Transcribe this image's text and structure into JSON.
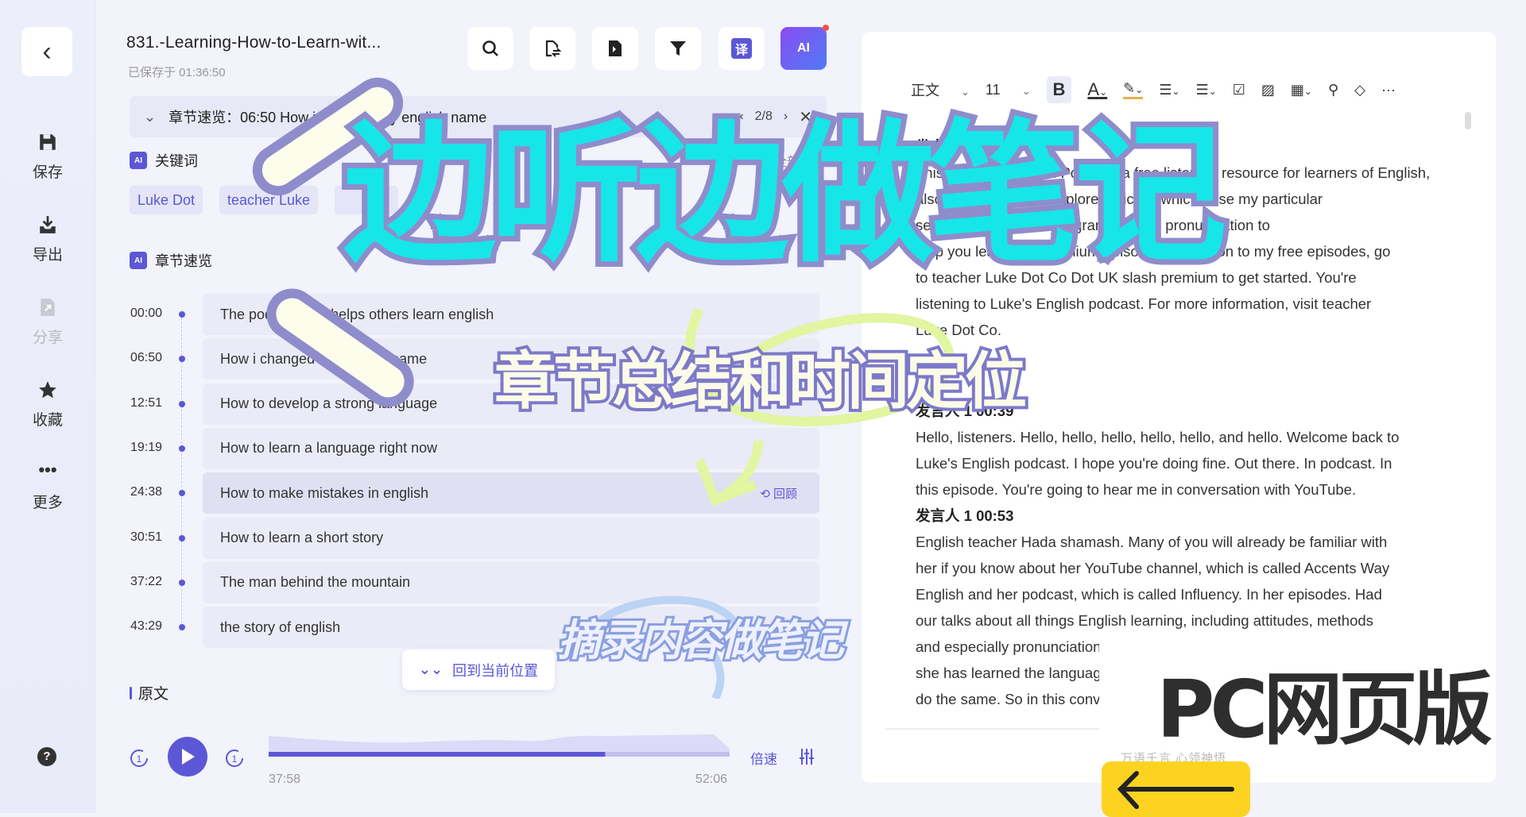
{
  "sidebar": {
    "items": [
      {
        "label": "保存"
      },
      {
        "label": "导出"
      },
      {
        "label": "分享"
      },
      {
        "label": "收藏"
      },
      {
        "label": "更多"
      }
    ],
    "help": "?"
  },
  "header": {
    "title": "831.-Learning-How-to-Learn-wit...",
    "saved": "已保存于 01:36:50",
    "ai_badge": "AI",
    "translate": "译"
  },
  "chapter_bar": {
    "label": "章节速览：06:50 How i changed my english name",
    "page": "2/8"
  },
  "keywords": {
    "heading": "关键词",
    "expand": "开全部",
    "chips": [
      "Luke Dot",
      "teacher Luke"
    ]
  },
  "chapters": {
    "heading": "章节速览",
    "review": "回顾",
    "items": [
      {
        "time": "00:00",
        "title": "The podcast that helps others learn english"
      },
      {
        "time": "06:50",
        "title": "How i changed my english name"
      },
      {
        "time": "12:51",
        "title": "How to develop a strong language"
      },
      {
        "time": "19:19",
        "title": "How to learn a language right now"
      },
      {
        "time": "24:38",
        "title": "How to make mistakes in english"
      },
      {
        "time": "30:51",
        "title": "How to learn a short story"
      },
      {
        "time": "37:22",
        "title": "The man behind the mountain"
      },
      {
        "time": "43:29",
        "title": " the story of english"
      }
    ]
  },
  "go_current": "回到当前位置",
  "original": "原文",
  "player": {
    "current": "37:58",
    "total": "52:06",
    "speed": "倍速",
    "progress": 0.73
  },
  "editor": {
    "style": "正文",
    "size": "11",
    "bold": "B",
    "more": "···",
    "blocks": [
      {
        "speaker": "发言人 1",
        "lines": [
          "This is Luke's English Podcast, a free listening resource for learners of English,",
          "also a place where I explore topics in which I use my particular",
          "set of skills, vocabulary, grammar and pronunciation to",
          "help you learn. For premium episodes in addition to my free episodes, go",
          "to teacher Luke Dot Co Dot UK slash premium to get started. You're",
          "listening to Luke's English podcast. For more information, visit teacher",
          "Luke Dot Co."
        ]
      },
      {
        "speaker": "发言人 1  00:39",
        "lines": [
          "Hello, listeners. Hello, hello, hello, hello, hello, and hello. Welcome back to",
          "Luke's English podcast. I hope you're doing fine. Out there. In podcast. In",
          "this episode. You're going to hear me in conversation with YouTube."
        ]
      },
      {
        "speaker": "发言人 1  00:53",
        "lines": [
          "English teacher Hada shamash. Many of you will already be familiar with",
          "her if you know about her YouTube channel, which is called Accents Way",
          "English and her podcast, which is called Influency. In her episodes. Had",
          "our talks about all things English learning, including attitudes, methods",
          "and especially pronunciation",
          "she has learned the language",
          "do the same. So in this conversation"
        ]
      }
    ],
    "footer": "万语千言  心领神悟"
  },
  "overlay": {
    "headline": "边听边做笔记",
    "subtitle": "章节总结和时间定位",
    "excerpt": "摘录内容做笔记",
    "platform": "PC网页版"
  },
  "colors": {
    "accent": "#5b57d6",
    "cyan": "#16e6e8",
    "yellow": "#fdd322"
  }
}
